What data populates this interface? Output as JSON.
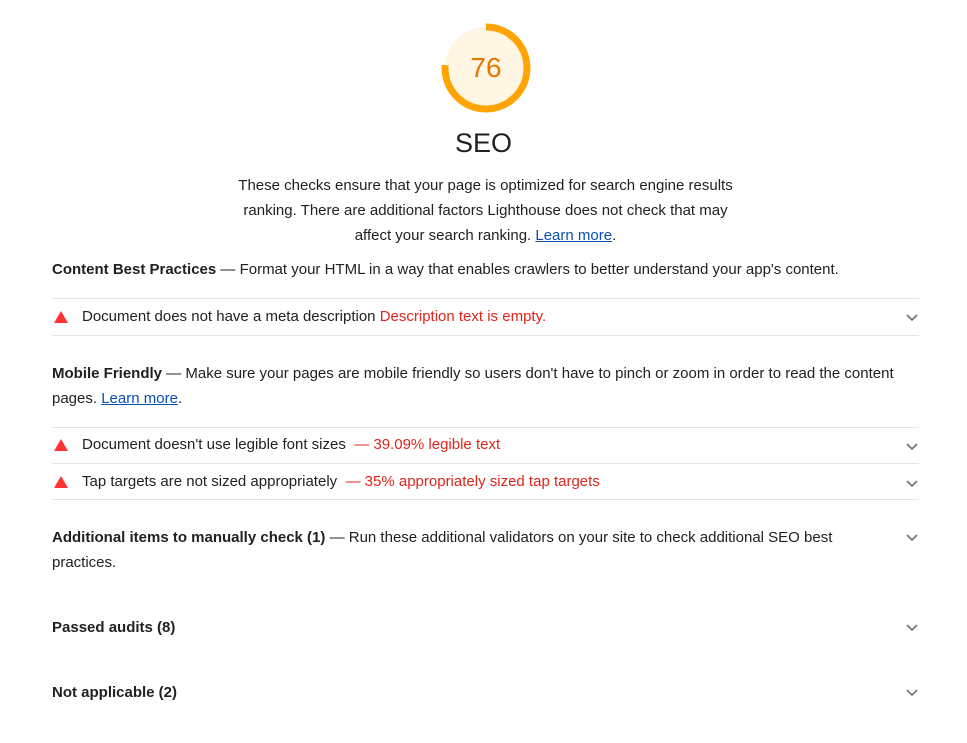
{
  "gauge": {
    "score": "76",
    "fraction": 0.76,
    "color": "#ffa400",
    "fill": "#fff5e3"
  },
  "category": {
    "title": "SEO",
    "description": "These checks ensure that your page is optimized for search engine results ranking. There are additional factors Lighthouse does not check that may affect your search ranking.",
    "learn_more": "Learn more",
    "period": "."
  },
  "groups": {
    "content": {
      "title": "Content Best Practices",
      "dash": " — ",
      "description": "Format your HTML in a way that enables crawlers to better understand your app's content.",
      "audits": [
        {
          "title": "Document does not have a meta description",
          "display": "Description text is empty."
        }
      ]
    },
    "mobile": {
      "title": "Mobile Friendly",
      "dash": " — ",
      "description": "Make sure your pages are mobile friendly so users don't have to pinch or zoom in order to read the content pages.",
      "learn_more": "Learn more",
      "period": ".",
      "audits": [
        {
          "title": "Document doesn't use legible font sizes",
          "display": "— 39.09% legible text"
        },
        {
          "title": "Tap targets are not sized appropriately",
          "display": "— 35% appropriately sized tap targets"
        }
      ]
    },
    "manual": {
      "title": "Additional items to manually check (1)",
      "dash": " — ",
      "description": "Run these additional validators on your site to check additional SEO best practices."
    }
  },
  "sections": {
    "passed": "Passed audits (8)",
    "not_applicable": "Not applicable (2)"
  },
  "icons": {
    "fail": "triangle-warning-icon",
    "expand": "chevron-down-icon"
  },
  "colors": {
    "fail": "#e0251b",
    "fail_icon": "#ff3333",
    "link": "#0b4fb3",
    "average": "#ffa400"
  }
}
